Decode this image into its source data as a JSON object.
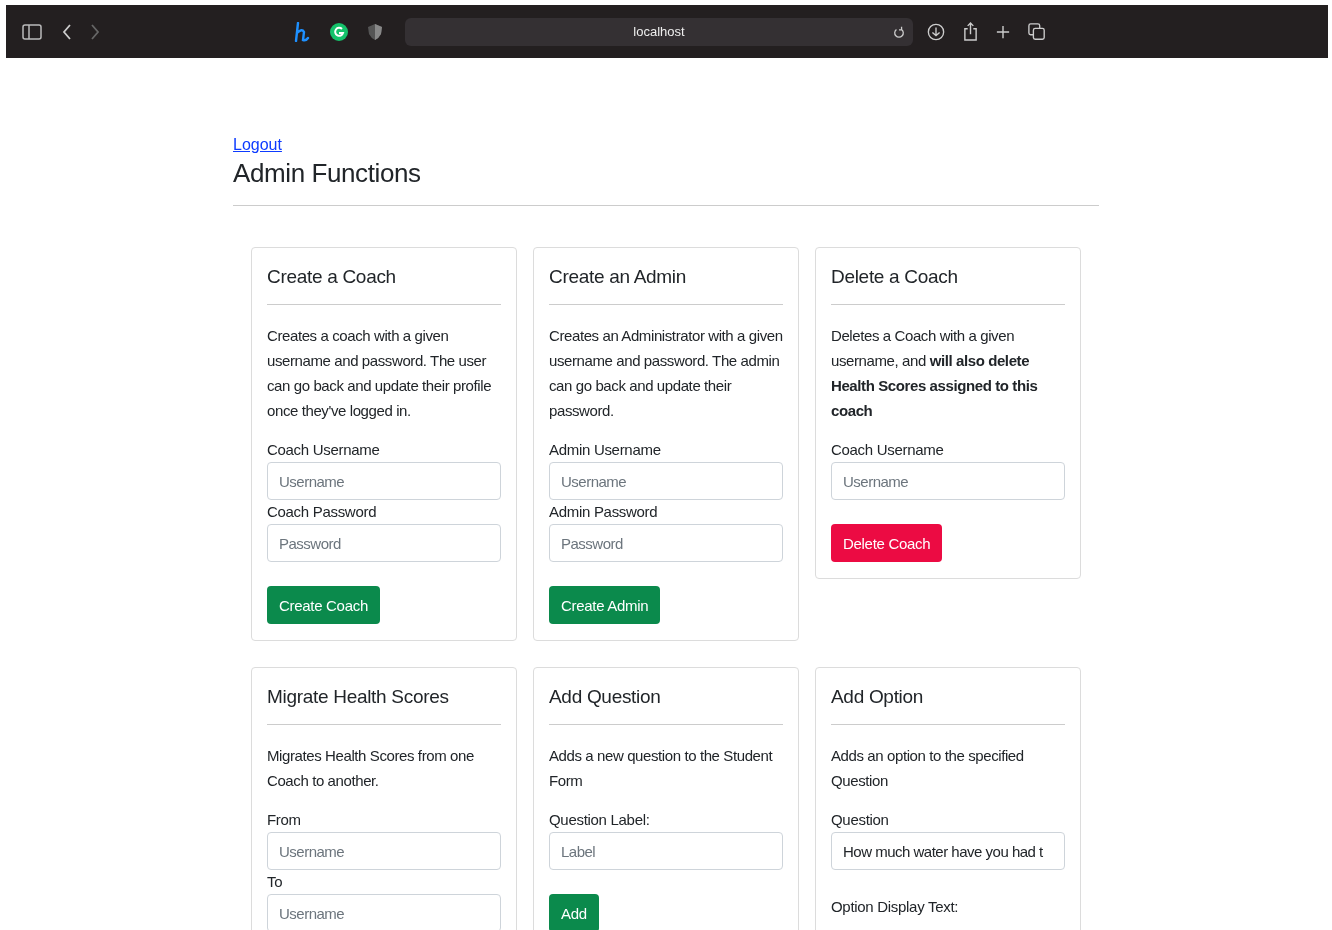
{
  "browser": {
    "address": "localhost"
  },
  "logout": "Logout",
  "title": "Admin Functions",
  "cards": [
    {
      "title": "Create a Coach",
      "description": "Creates a coach with a given username and password. The user can go back and update their profile once they've logged in.",
      "groups": [
        {
          "fields": [
            {
              "label": "Coach Username",
              "placeholder": "Username"
            },
            {
              "label": "Coach Password",
              "placeholder": "Password"
            }
          ]
        }
      ],
      "button": {
        "label": "Create Coach",
        "kind": "success"
      }
    },
    {
      "title": "Create an Admin",
      "description": "Creates an Administrator with a given username and password. The admin can go back and update their password.",
      "groups": [
        {
          "fields": [
            {
              "label": "Admin Username",
              "placeholder": "Username"
            },
            {
              "label": "Admin Password",
              "placeholder": "Password"
            }
          ]
        }
      ],
      "button": {
        "label": "Create Admin",
        "kind": "success"
      }
    },
    {
      "title": "Delete a Coach",
      "description": "Deletes a Coach with a given username, and **will also delete Health Scores assigned to this coach**",
      "groups": [
        {
          "fields": [
            {
              "label": "Coach Username",
              "placeholder": "Username"
            }
          ]
        }
      ],
      "button": {
        "label": "Delete Coach",
        "kind": "danger"
      }
    },
    {
      "title": "Migrate Health Scores",
      "description": "Migrates Health Scores from one Coach to another.",
      "groups": [
        {
          "fields": [
            {
              "label": "From",
              "placeholder": "Username"
            },
            {
              "label": "To",
              "placeholder": "Username"
            }
          ]
        }
      ]
    },
    {
      "title": "Add Question",
      "description": "Adds a new question to the Student Form",
      "groups": [
        {
          "fields": [
            {
              "label": "Question Label:",
              "placeholder": "Label"
            }
          ]
        }
      ],
      "button": {
        "label": "Add",
        "kind": "success"
      }
    },
    {
      "title": "Add Option",
      "description": "Adds an option to the specified Question",
      "groups": [
        {
          "fields": [
            {
              "label": "Question",
              "value": "How much water have you had t"
            }
          ]
        },
        {
          "fields": [
            {
              "label": "Option Display Text:"
            }
          ]
        }
      ]
    }
  ]
}
